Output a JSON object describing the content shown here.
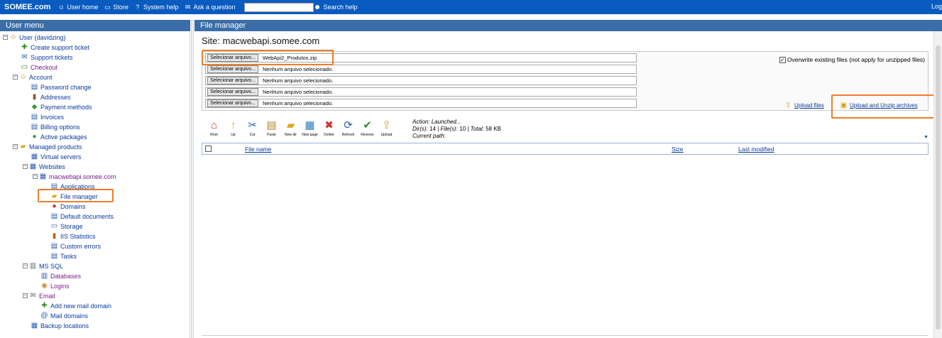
{
  "topbar": {
    "brand": "SOMEE.com",
    "nav": [
      {
        "label": "User home",
        "icon": "user-icon"
      },
      {
        "label": "Store",
        "icon": "cart-icon"
      },
      {
        "label": "System help",
        "icon": "help-icon"
      },
      {
        "label": "Ask a question",
        "icon": "mail-icon"
      }
    ],
    "search_label": "Search help",
    "logout": "Log"
  },
  "left_panel": {
    "title": "User menu",
    "tree": [
      {
        "label": "User (davidzing)",
        "icon": "user-icon",
        "level": 0,
        "toggle": "-"
      },
      {
        "label": "Create support ticket",
        "icon": "ticket-add-icon",
        "level": 1
      },
      {
        "label": "Support tickets",
        "icon": "tickets-icon",
        "level": 1
      },
      {
        "label": "Checkout",
        "icon": "cart-icon",
        "level": 1
      },
      {
        "label": "Account",
        "icon": "account-icon",
        "level": 1,
        "toggle": "-"
      },
      {
        "label": "Password change",
        "icon": "password-icon",
        "level": 2
      },
      {
        "label": "Addresses",
        "icon": "address-book-icon",
        "level": 2
      },
      {
        "label": "Payment methods",
        "icon": "payment-icon",
        "level": 2
      },
      {
        "label": "Invoices",
        "icon": "invoice-icon",
        "level": 2
      },
      {
        "label": "Billing options",
        "icon": "billing-icon",
        "level": 2
      },
      {
        "label": "Active packages",
        "icon": "package-icon",
        "level": 2
      },
      {
        "label": "Managed products",
        "icon": "folder-icon",
        "level": 1,
        "toggle": "-"
      },
      {
        "label": "Virtual servers",
        "icon": "server-icon",
        "level": 2
      },
      {
        "label": "Websites",
        "icon": "websites-icon",
        "level": 2,
        "toggle": "-"
      },
      {
        "label": "macwebapi.somee.com",
        "icon": "website-icon",
        "level": 3,
        "toggle": "-"
      },
      {
        "label": "Applications",
        "icon": "applications-icon",
        "level": 4
      },
      {
        "label": "File manager",
        "icon": "file-manager-icon",
        "level": 4,
        "highlight": true
      },
      {
        "label": "Domains",
        "icon": "domains-icon",
        "level": 4
      },
      {
        "label": "Default documents",
        "icon": "default-docs-icon",
        "level": 4
      },
      {
        "label": "Storage",
        "icon": "storage-icon",
        "level": 4
      },
      {
        "label": "IIS Statistics",
        "icon": "statistics-icon",
        "level": 4
      },
      {
        "label": "Custom errors",
        "icon": "custom-errors-icon",
        "level": 4
      },
      {
        "label": "Tasks",
        "icon": "tasks-icon",
        "level": 4
      },
      {
        "label": "MS SQL",
        "icon": "database-server-icon",
        "level": 2,
        "toggle": "-"
      },
      {
        "label": "Databases",
        "icon": "database-icon",
        "level": 3
      },
      {
        "label": "Logins",
        "icon": "logins-icon",
        "level": 3
      },
      {
        "label": "Email",
        "icon": "email-icon",
        "level": 2,
        "toggle": "-"
      },
      {
        "label": "Add new mail domain",
        "icon": "add-icon",
        "level": 3
      },
      {
        "label": "Mail domains",
        "icon": "mail-domains-icon",
        "level": 3
      },
      {
        "label": "Backup locations",
        "icon": "backup-icon",
        "level": 2
      }
    ]
  },
  "right_panel": {
    "title": "File manager",
    "site_title": "Site: macwebapi.somee.com",
    "file_inputs": [
      {
        "button": "Selecionar arquivo...",
        "value": "WebApi2_Produtos.zip"
      },
      {
        "button": "Selecionar arquivo...",
        "value": "Nenhum arquivo selecionado."
      },
      {
        "button": "Selecionar arquivo...",
        "value": "Nenhum arquivo selecionado."
      },
      {
        "button": "Selecionar arquivo...",
        "value": "Nenhum arquivo selecionado."
      },
      {
        "button": "Selecionar arquivo...",
        "value": "Nenhum arquivo selecionado."
      }
    ],
    "overwrite_label": "Overwrite existing files (not apply for unzipped files)",
    "overwrite_checked": true,
    "upload_files": "Upload files",
    "upload_unzip": "Upload and Unzip archives",
    "toolbar": [
      {
        "label": "Root",
        "icon": "root-icon",
        "glyph": "⌂",
        "color": "#c0392b"
      },
      {
        "label": "Up",
        "icon": "up-folder-icon",
        "glyph": "↑",
        "color": "#e0a520"
      },
      {
        "label": "Cut",
        "icon": "cut-icon",
        "glyph": "✂",
        "color": "#2a5db0"
      },
      {
        "label": "Paste",
        "icon": "paste-icon",
        "glyph": "▤",
        "color": "#b8862b"
      },
      {
        "label": "New dir",
        "icon": "new-folder-icon",
        "glyph": "▰",
        "color": "#e0a520"
      },
      {
        "label": "New page",
        "icon": "new-page-icon",
        "glyph": "▦",
        "color": "#2a7ac0"
      },
      {
        "label": "Delete",
        "icon": "delete-icon",
        "glyph": "✖",
        "color": "#d0302a"
      },
      {
        "label": "Refresh",
        "icon": "refresh-icon",
        "glyph": "⟳",
        "color": "#2a5db0"
      },
      {
        "label": "Reverse",
        "icon": "reverse-icon",
        "glyph": "✔",
        "color": "#2f8a2f"
      },
      {
        "label": "Upload",
        "icon": "upload-icon",
        "glyph": "⇪",
        "color": "#e0a520"
      }
    ],
    "status": {
      "action_label": "Action:",
      "action_value": "Launched...",
      "dirs_label": "Dir(s):",
      "dirs_value": "14",
      "files_label": "File(s):",
      "files_value": "10",
      "total_label": "Total:",
      "total_value": "58 KB",
      "path_label": "Current path:"
    },
    "table_headers": {
      "name": "File name",
      "size": "Size",
      "modified": "Last modified"
    }
  }
}
